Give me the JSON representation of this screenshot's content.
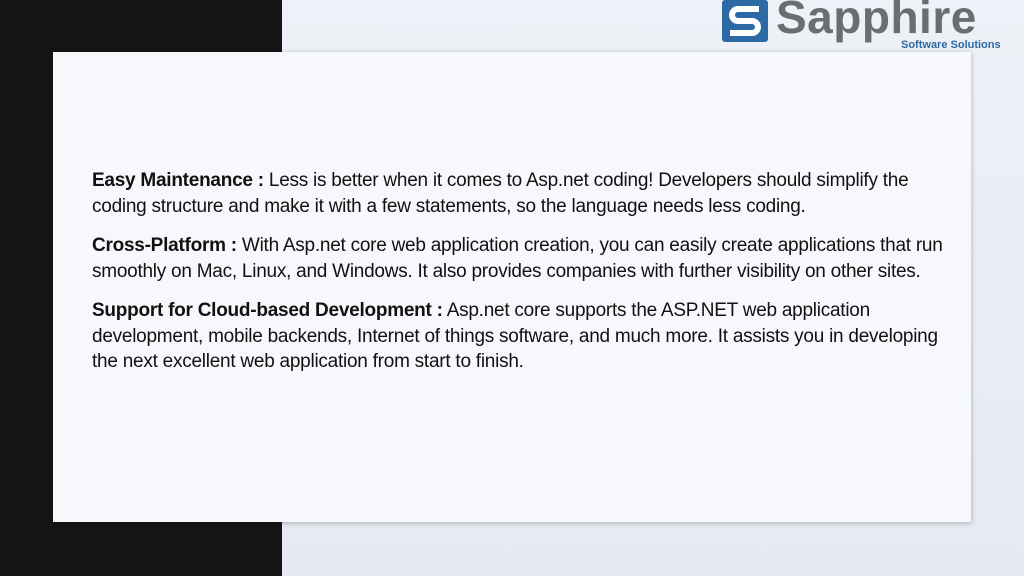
{
  "logo": {
    "name": "Sapphire",
    "tagline": "Software Solutions",
    "icon": "sapphire-s-logo-mark",
    "colors": {
      "name": "#6a6d72",
      "tagline": "#2c6aa6",
      "mark": "#2c6aa6"
    }
  },
  "sections": [
    {
      "heading": "Easy Maintenance :",
      "body": "Less is better when it comes to Asp.net coding! Developers should simplify the coding structure and make it with a few statements, so the language needs less coding."
    },
    {
      "heading": "Cross-Platform :",
      "body": "With Asp.net core web application creation, you can easily create applications that run smoothly on Mac, Linux, and Windows. It also provides companies with further visibility on other sites."
    },
    {
      "heading": "Support for Cloud-based Development :",
      "body": "Asp.net core supports the ASP.NET web application development, mobile backends, Internet of things software, and much more. It assists you in developing the next excellent web application from start to finish."
    }
  ]
}
